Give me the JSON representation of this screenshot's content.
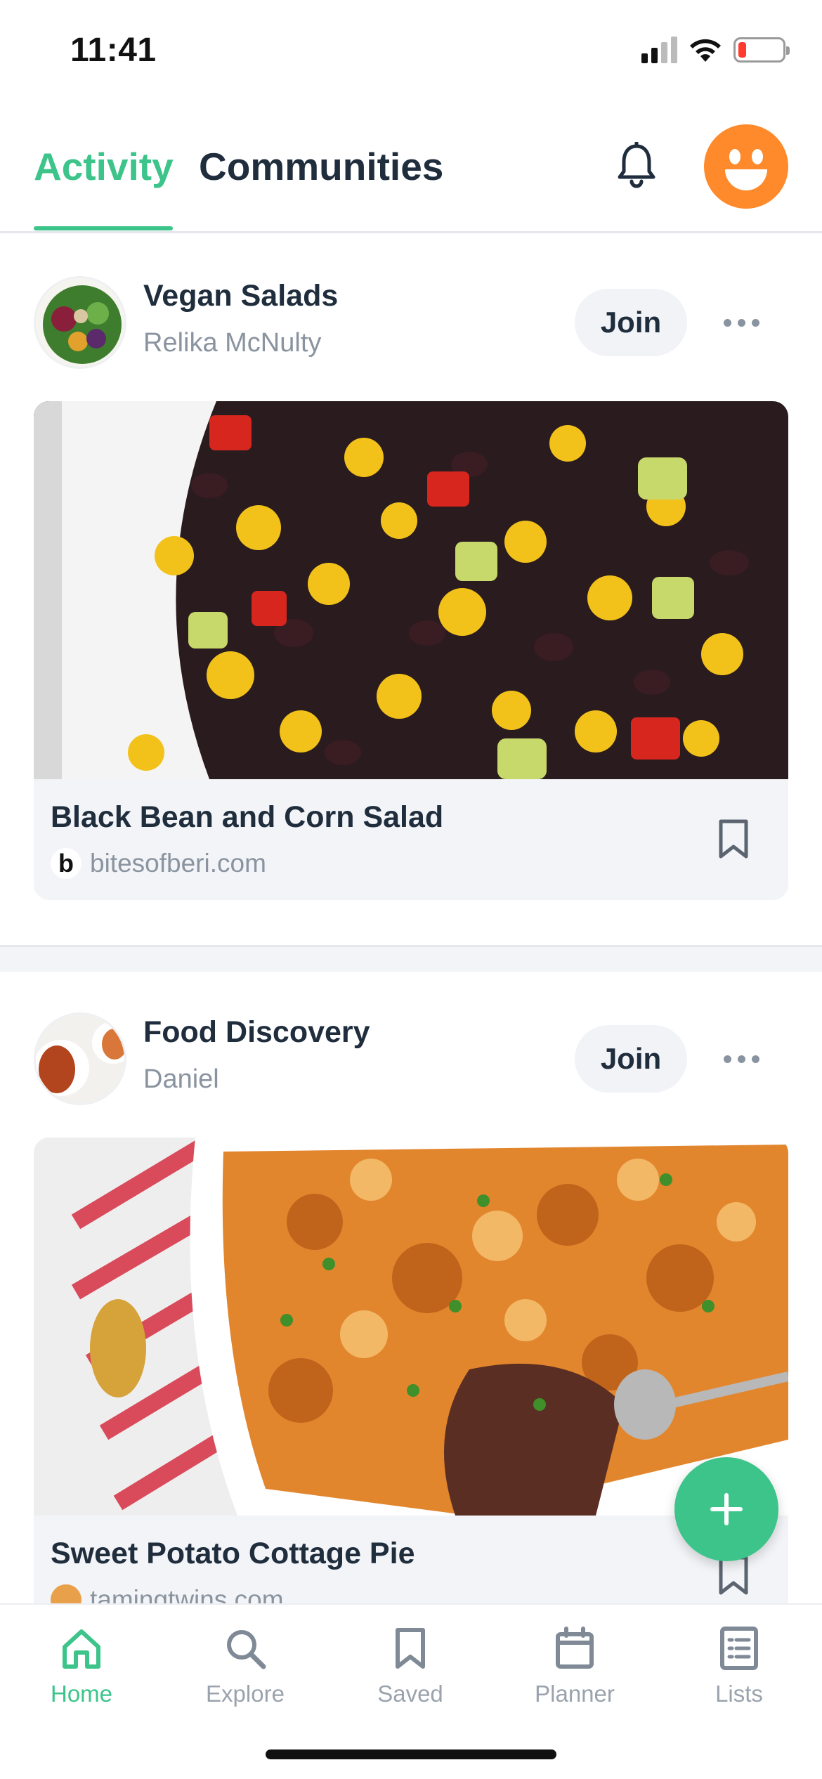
{
  "status_bar": {
    "time": "11:41",
    "battery_level": 0.18
  },
  "header": {
    "tabs": [
      {
        "label": "Activity",
        "active": true
      },
      {
        "label": "Communities",
        "active": false
      }
    ],
    "icons": [
      "bell-icon",
      "smiley-avatar-icon"
    ]
  },
  "colors": {
    "accent": "#3cc48a",
    "avatar": "#ff8a2b",
    "text": "#1f2d3d",
    "muted": "#8a94a0"
  },
  "feed": [
    {
      "community": "Vegan Salads",
      "user": "Relika McNulty",
      "join_label": "Join",
      "recipe_title": "Black Bean and Corn Salad",
      "source_initial": "b",
      "source": "bitesofberi.com"
    },
    {
      "community": "Food Discovery",
      "user": "Daniel",
      "join_label": "Join",
      "recipe_title": "Sweet Potato Cottage Pie",
      "source_initial": "",
      "source": "tamingtwins.com"
    }
  ],
  "fab": {
    "icon": "plus-icon"
  },
  "bottom_nav": [
    {
      "label": "Home",
      "icon": "home-icon",
      "active": true
    },
    {
      "label": "Explore",
      "icon": "search-icon",
      "active": false
    },
    {
      "label": "Saved",
      "icon": "bookmark-icon",
      "active": false
    },
    {
      "label": "Planner",
      "icon": "calendar-icon",
      "active": false
    },
    {
      "label": "Lists",
      "icon": "list-icon",
      "active": false
    }
  ]
}
